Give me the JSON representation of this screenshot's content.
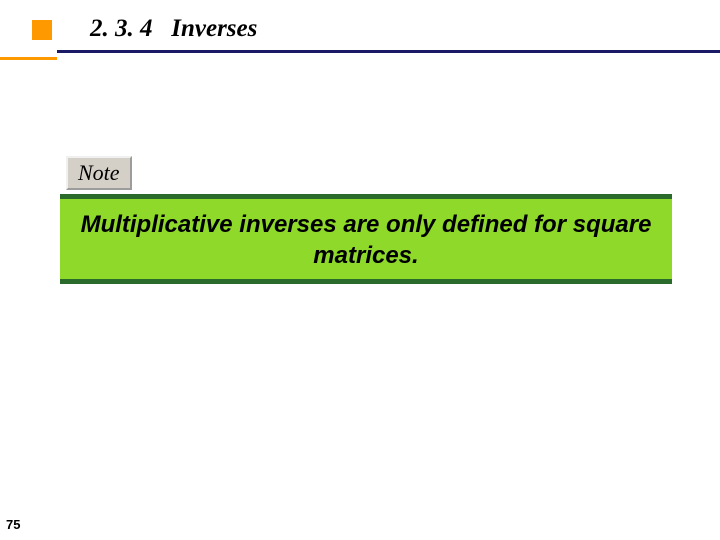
{
  "header": {
    "section_number": "2. 3. 4",
    "title": "Inverses"
  },
  "note": {
    "label": "Note",
    "body": "Multiplicative inverses are only defined for square matrices."
  },
  "page_number": "75"
}
